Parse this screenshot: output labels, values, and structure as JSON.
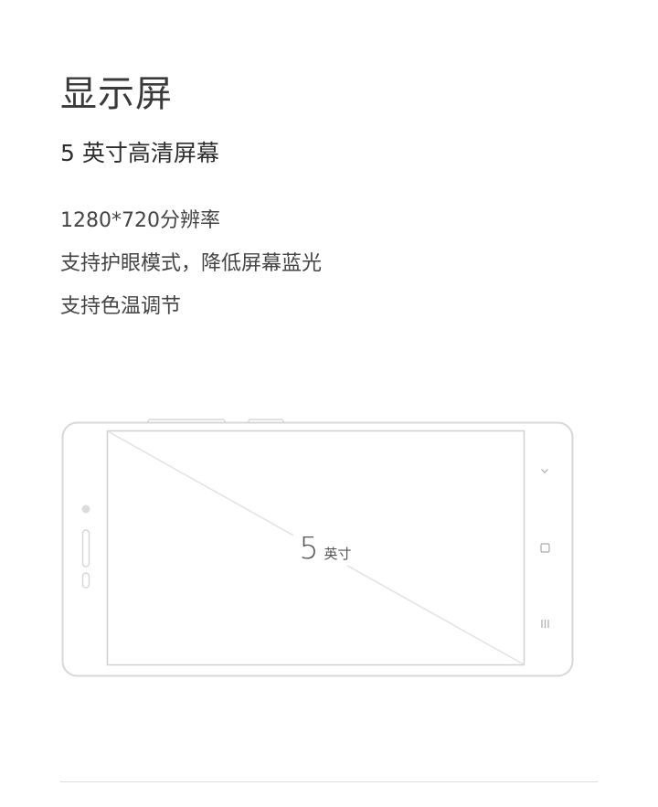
{
  "section": {
    "title": "显示屏",
    "subtitle": "5 英寸高清屏幕",
    "features": [
      "1280*720分辨率",
      "支持护眼模式，降低屏幕蓝光",
      "支持色温调节"
    ]
  },
  "phone_illustration": {
    "screen_size_number": "5",
    "screen_size_unit": "英寸",
    "nav_buttons": [
      "back-icon",
      "home-icon",
      "menu-icon"
    ],
    "outline_color": "#d7d7d7",
    "diagonal_color": "#e2e2e2"
  }
}
